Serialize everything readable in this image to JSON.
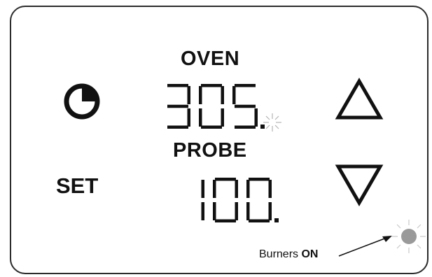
{
  "oven": {
    "label": "OVEN",
    "digits": "305"
  },
  "probe": {
    "label": "PROBE",
    "digits": "100"
  },
  "set_button": {
    "label": "SET"
  },
  "timer_button": {
    "icon": "pie-timer-icon"
  },
  "up_button": {
    "icon": "triangle-up-icon"
  },
  "down_button": {
    "icon": "triangle-down-icon"
  },
  "burners_indicator": {
    "caption_prefix": "Burners",
    "caption_state": "ON",
    "color": "#9a9a9a"
  },
  "flash_indicator": {
    "icon": "sparkle-icon"
  },
  "colors": {
    "ink": "#111111",
    "border": "#2b2b2b",
    "led": "#9a9a9a"
  }
}
